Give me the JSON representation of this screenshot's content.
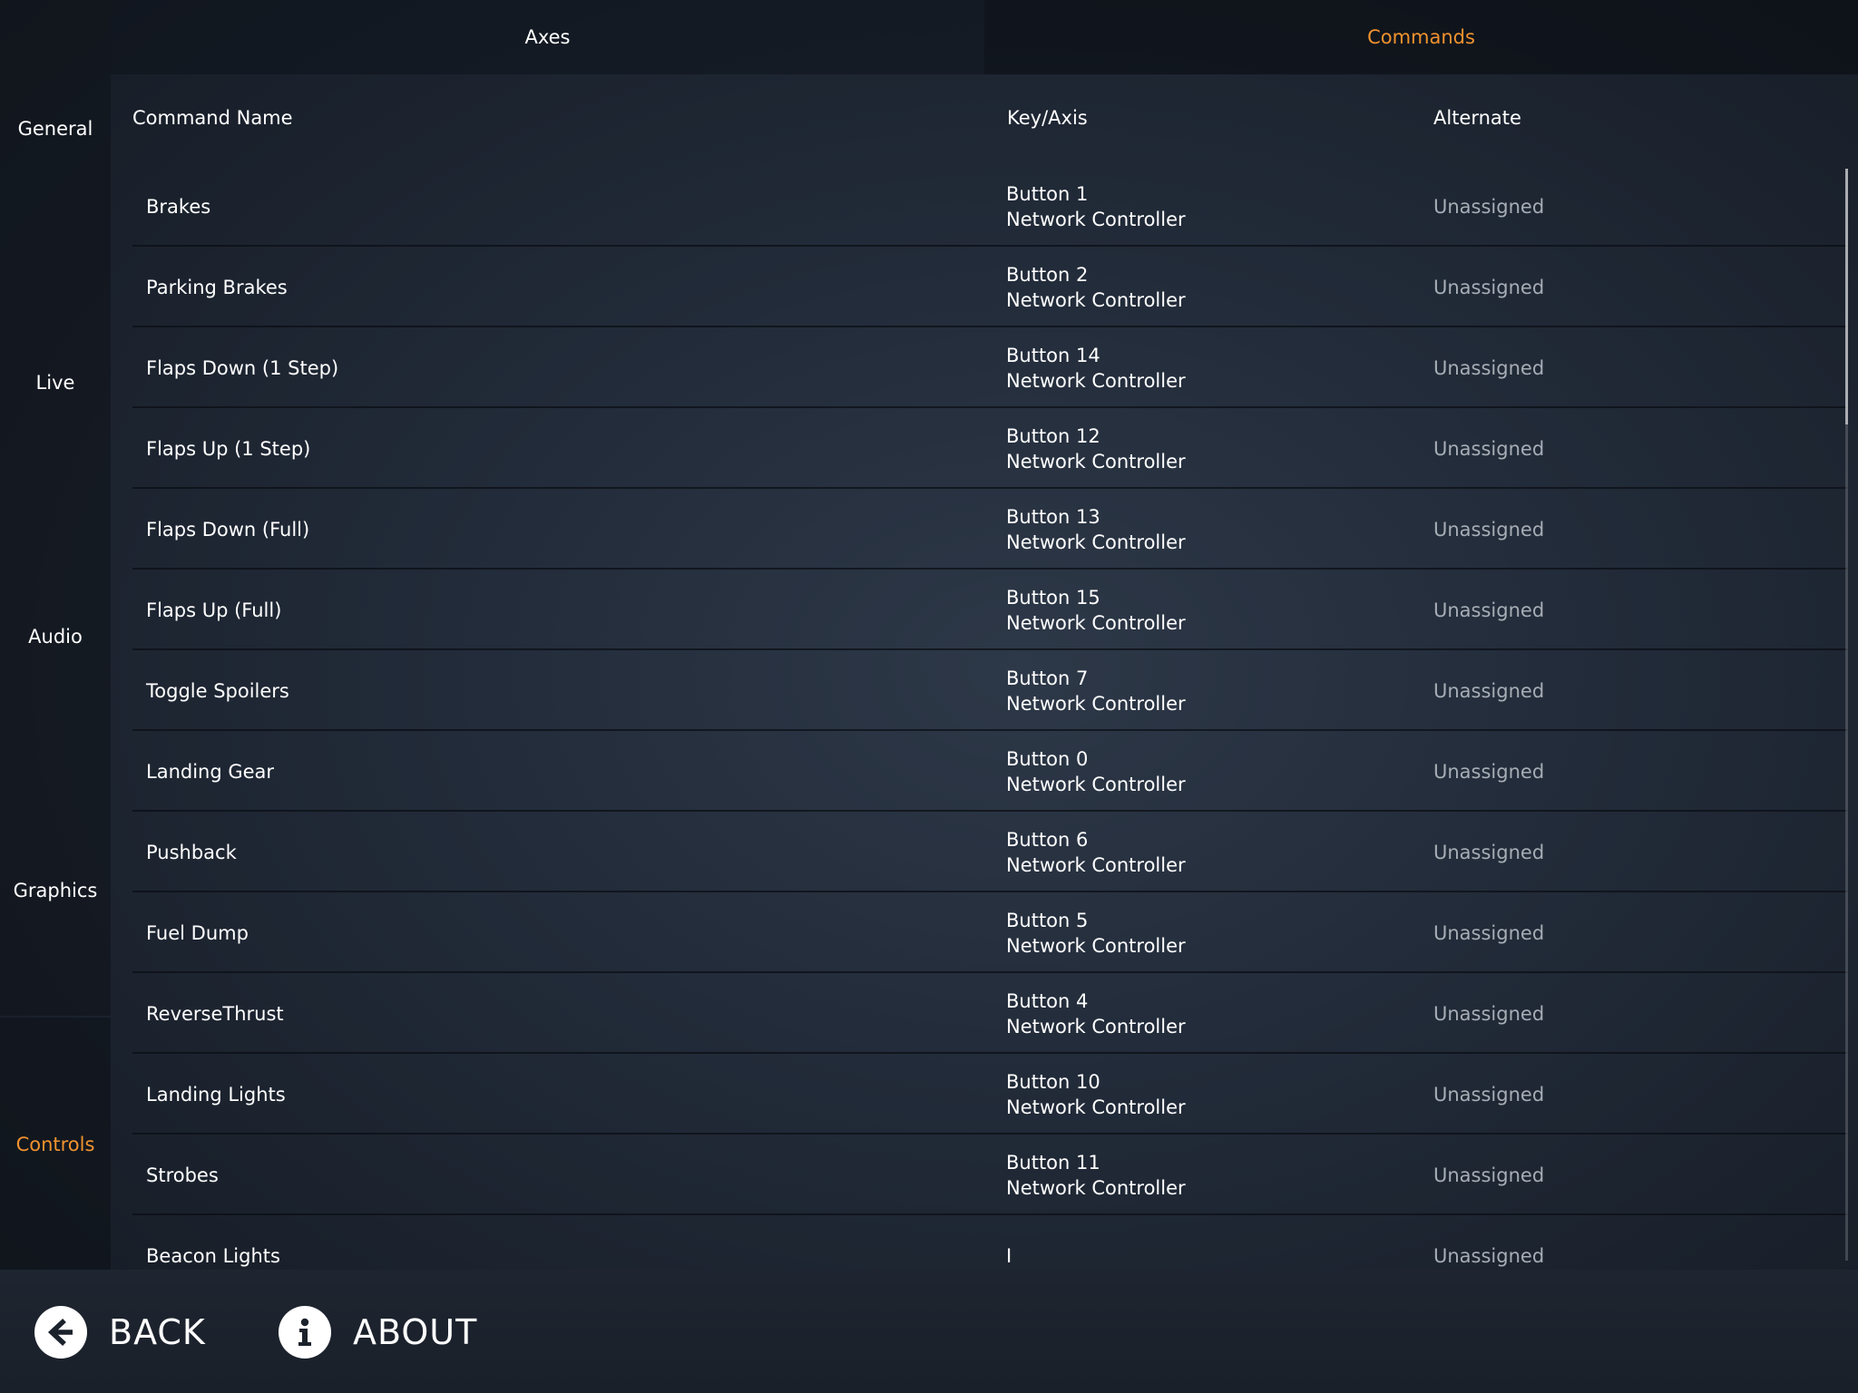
{
  "sidebar": {
    "items": [
      {
        "label": "General"
      },
      {
        "label": "Live"
      },
      {
        "label": "Audio"
      },
      {
        "label": "Graphics"
      },
      {
        "label": "Controls"
      }
    ],
    "active": "Controls"
  },
  "tabs": [
    {
      "label": "Axes"
    },
    {
      "label": "Commands"
    }
  ],
  "active_tab": "Commands",
  "accent_color": "#f0922e",
  "table": {
    "headers": {
      "name": "Command Name",
      "key": "Key/Axis",
      "alternate": "Alternate"
    },
    "rows": [
      {
        "name": "Brakes",
        "key_line1": "Button 1",
        "key_line2": "Network Controller",
        "alternate": "Unassigned"
      },
      {
        "name": "Parking Brakes",
        "key_line1": "Button 2",
        "key_line2": "Network Controller",
        "alternate": "Unassigned"
      },
      {
        "name": "Flaps Down (1 Step)",
        "key_line1": "Button 14",
        "key_line2": "Network Controller",
        "alternate": "Unassigned"
      },
      {
        "name": "Flaps Up (1 Step)",
        "key_line1": "Button 12",
        "key_line2": "Network Controller",
        "alternate": "Unassigned"
      },
      {
        "name": "Flaps Down (Full)",
        "key_line1": "Button 13",
        "key_line2": "Network Controller",
        "alternate": "Unassigned"
      },
      {
        "name": "Flaps Up (Full)",
        "key_line1": "Button 15",
        "key_line2": "Network Controller",
        "alternate": "Unassigned"
      },
      {
        "name": "Toggle Spoilers",
        "key_line1": "Button 7",
        "key_line2": "Network Controller",
        "alternate": "Unassigned"
      },
      {
        "name": "Landing Gear",
        "key_line1": "Button 0",
        "key_line2": "Network Controller",
        "alternate": "Unassigned"
      },
      {
        "name": "Pushback",
        "key_line1": "Button 6",
        "key_line2": "Network Controller",
        "alternate": "Unassigned"
      },
      {
        "name": "Fuel Dump",
        "key_line1": "Button 5",
        "key_line2": "Network Controller",
        "alternate": "Unassigned"
      },
      {
        "name": "ReverseThrust",
        "key_line1": "Button 4",
        "key_line2": "Network Controller",
        "alternate": "Unassigned"
      },
      {
        "name": "Landing Lights",
        "key_line1": "Button 10",
        "key_line2": "Network Controller",
        "alternate": "Unassigned"
      },
      {
        "name": "Strobes",
        "key_line1": "Button 11",
        "key_line2": "Network Controller",
        "alternate": "Unassigned"
      },
      {
        "name": "Beacon Lights",
        "key_line1": "I",
        "key_line2": "",
        "alternate": "Unassigned"
      }
    ]
  },
  "bottom": {
    "back_label": "BACK",
    "back_icon": "arrow-left-icon",
    "about_label": "ABOUT",
    "about_icon": "info-icon"
  }
}
